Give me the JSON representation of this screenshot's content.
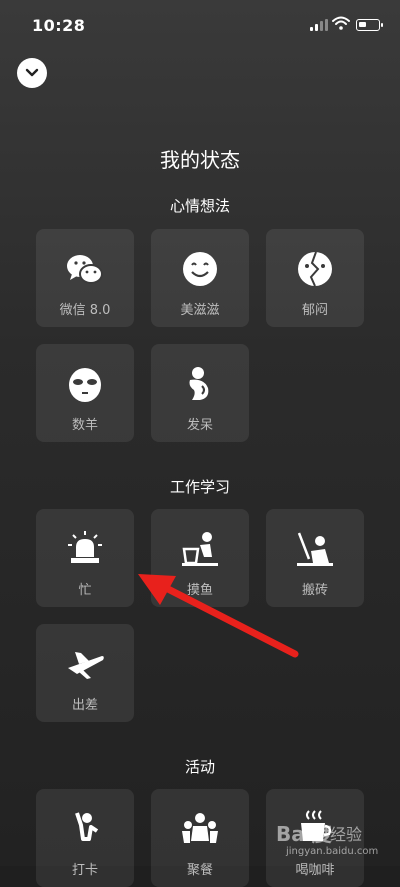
{
  "status_bar": {
    "time": "10:28"
  },
  "page": {
    "title": "我的状态"
  },
  "sections": [
    {
      "title": "心情想法",
      "items": [
        {
          "label": "微信 8.0",
          "icon": "wechat-icon"
        },
        {
          "label": "美滋滋",
          "icon": "smile-face-icon"
        },
        {
          "label": "郁闷",
          "icon": "broken-face-icon"
        },
        {
          "label": "数羊",
          "icon": "sleepy-face-icon"
        },
        {
          "label": "发呆",
          "icon": "daze-figure-icon"
        }
      ]
    },
    {
      "title": "工作学习",
      "items": [
        {
          "label": "忙",
          "icon": "alarm-siren-icon"
        },
        {
          "label": "摸鱼",
          "icon": "person-at-desk-icon"
        },
        {
          "label": "搬砖",
          "icon": "person-working-icon"
        },
        {
          "label": "出差",
          "icon": "airplane-icon"
        }
      ]
    },
    {
      "title": "活动",
      "items": [
        {
          "label": "打卡",
          "icon": "checkin-figure-icon"
        },
        {
          "label": "聚餐",
          "icon": "group-people-icon"
        },
        {
          "label": "喝咖啡",
          "icon": "coffee-cup-icon"
        }
      ]
    }
  ],
  "watermark": {
    "logo": "Bai度",
    "text": "经验",
    "url": "jingyan.baidu.com"
  },
  "colors": {
    "annotation_arrow": "#e8211c"
  }
}
